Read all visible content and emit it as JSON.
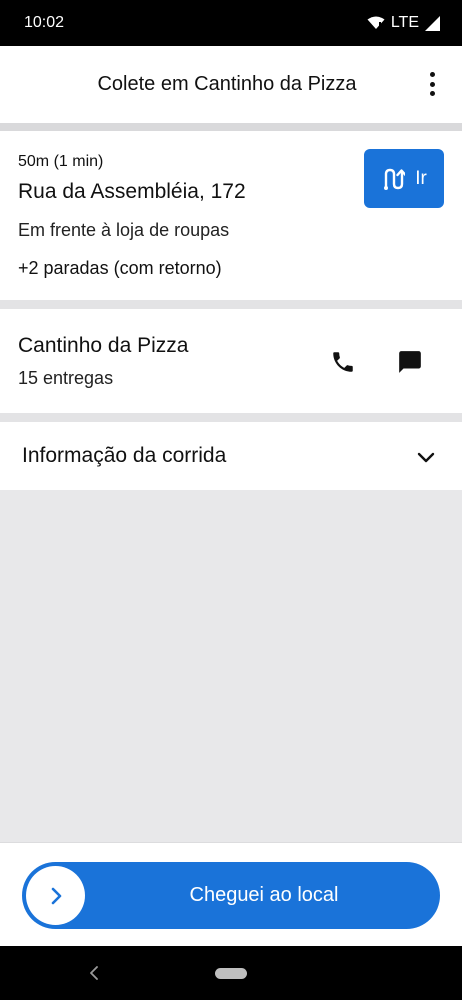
{
  "status_bar": {
    "time": "10:02",
    "network": "LTE"
  },
  "app_bar": {
    "title": "Colete em Cantinho da Pizza",
    "menu_icon": "more-vert-icon"
  },
  "stop": {
    "eta": "50m (1 min)",
    "address": "Rua da Assembléia, 172",
    "reference": "Em frente à loja de roupas",
    "extra_stops": "+2 paradas (com retorno)",
    "go_label": "Ir",
    "go_icon": "route-icon"
  },
  "merchant": {
    "name": "Cantinho da Pizza",
    "deliveries": "15 entregas",
    "phone_icon": "phone-icon",
    "chat_icon": "chat-icon"
  },
  "ride_info": {
    "title": "Informação da corrida",
    "expand_icon": "chevron-down-icon"
  },
  "arrive": {
    "label": "Cheguei ao local",
    "knob_icon": "chevron-right-icon"
  },
  "colors": {
    "accent": "#1a73d9",
    "background": "#e8e8ea",
    "surface": "#ffffff"
  }
}
